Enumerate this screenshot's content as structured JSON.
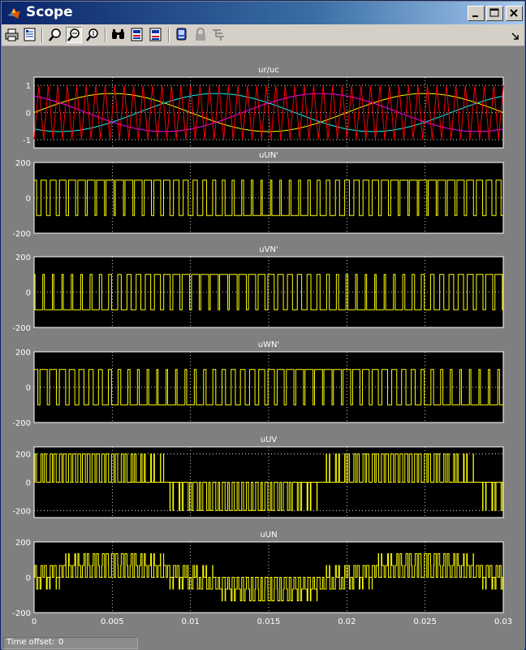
{
  "window": {
    "title": "Scope"
  },
  "toolbar": {
    "buttons": [
      {
        "name": "print",
        "icon": "printer-icon"
      },
      {
        "name": "parameters",
        "icon": "parameters-icon"
      },
      {
        "name": "zoom",
        "icon": "zoom-icon"
      },
      {
        "name": "zoom-x",
        "icon": "zoom-x-axis-icon",
        "pressed": true
      },
      {
        "name": "zoom-y",
        "icon": "zoom-y-axis-icon"
      },
      {
        "name": "autoscale",
        "icon": "binoculars-icon"
      },
      {
        "name": "save-axes",
        "icon": "save-axes-settings-icon"
      },
      {
        "name": "restore-axes",
        "icon": "restore-axes-settings-icon"
      },
      {
        "name": "floating-scope",
        "icon": "floating-scope-icon"
      },
      {
        "name": "lock-axes",
        "icon": "lock-icon"
      },
      {
        "name": "signal-selection",
        "icon": "signal-selection-icon"
      }
    ],
    "dock_icon": "dock-arrow-icon"
  },
  "colors": {
    "plot_bg": "#000000",
    "figure_bg": "#7f7f7f",
    "trace_yellow": "#ffff00",
    "trace_cyan": "#00ffff",
    "trace_magenta": "#ff00ff",
    "trace_red": "#ff0000",
    "grid": "#ffffff"
  },
  "status": {
    "label": "Time offset:",
    "value": "0"
  },
  "chart_data": [
    {
      "type": "line",
      "title": "ur/uc",
      "ylim": [
        -1.3,
        1.3
      ],
      "yticks": [
        "1",
        "0",
        "-1"
      ],
      "xlim": [
        0,
        0.03
      ],
      "grid": true,
      "series": [
        {
          "kind": "sine",
          "amplitude": 0.7,
          "frequency": 50,
          "phase_deg": 0,
          "color": "#ffff00"
        },
        {
          "kind": "sine",
          "amplitude": 0.7,
          "frequency": 50,
          "phase_deg": -120,
          "color": "#00ffff"
        },
        {
          "kind": "sine",
          "amplitude": 0.7,
          "frequency": 50,
          "phase_deg": 120,
          "color": "#ff00ff"
        },
        {
          "kind": "triangle",
          "amplitude": 1,
          "frequency": 1650,
          "color": "#ff0000"
        }
      ]
    },
    {
      "type": "line",
      "title": "uUN'",
      "ylim": [
        -200,
        200
      ],
      "yticks": [
        "200",
        "0",
        "-200"
      ],
      "xlim": [
        0,
        0.03
      ],
      "grid": true,
      "series": [
        {
          "kind": "pwm",
          "amplitude": 100,
          "modulation": 0.7,
          "carrier_frequency": 1650,
          "frequency": 50,
          "phase_deg": 0,
          "color": "#ffff00"
        }
      ]
    },
    {
      "type": "line",
      "title": "uVN'",
      "ylim": [
        -200,
        200
      ],
      "yticks": [
        "200",
        "0",
        "-200"
      ],
      "xlim": [
        0,
        0.03
      ],
      "grid": true,
      "series": [
        {
          "kind": "pwm",
          "amplitude": 100,
          "modulation": 0.7,
          "carrier_frequency": 1650,
          "frequency": 50,
          "phase_deg": -120,
          "color": "#ffff00"
        }
      ]
    },
    {
      "type": "line",
      "title": "uWN'",
      "ylim": [
        -200,
        200
      ],
      "yticks": [
        "200",
        "0",
        "-200"
      ],
      "xlim": [
        0,
        0.03
      ],
      "grid": true,
      "series": [
        {
          "kind": "pwm",
          "amplitude": 100,
          "modulation": 0.7,
          "carrier_frequency": 1650,
          "frequency": 50,
          "phase_deg": 120,
          "color": "#ffff00"
        }
      ]
    },
    {
      "type": "line",
      "title": "uUV",
      "ylim": [
        -250,
        250
      ],
      "yticks": [
        "200",
        "0",
        "-200"
      ],
      "xlim": [
        0,
        0.03
      ],
      "grid": true,
      "series": [
        {
          "kind": "pwm_diff",
          "amplitude": 100,
          "modulation": 0.7,
          "carrier_frequency": 1650,
          "frequency": 50,
          "phase_a_deg": 0,
          "phase_b_deg": -120,
          "color": "#ffff00"
        }
      ]
    },
    {
      "type": "line",
      "title": "uUN",
      "ylim": [
        -200,
        200
      ],
      "yticks": [
        "200",
        "0",
        "-200"
      ],
      "xlim": [
        0,
        0.03
      ],
      "grid": true,
      "xticks": [
        "0",
        "0.005",
        "0.01",
        "0.015",
        "0.02",
        "0.025",
        "0.03"
      ],
      "series": [
        {
          "kind": "pwm_phase",
          "amplitude": 100,
          "modulation": 0.7,
          "carrier_frequency": 1650,
          "frequency": 50,
          "phase_deg": 0,
          "color": "#ffff00"
        }
      ]
    }
  ]
}
